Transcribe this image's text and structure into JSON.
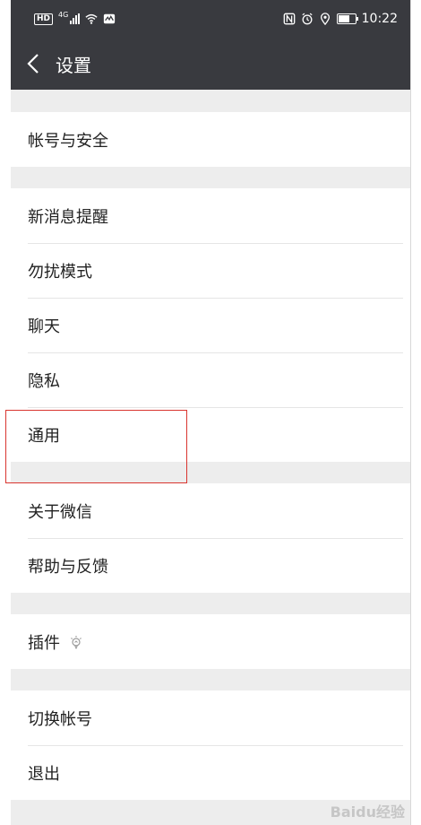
{
  "status_bar": {
    "hd": "HD",
    "network": "4G",
    "time": "10:22"
  },
  "header": {
    "title": "设置"
  },
  "groups": [
    {
      "items": [
        {
          "label": "帐号与安全"
        }
      ]
    },
    {
      "items": [
        {
          "label": "新消息提醒"
        },
        {
          "label": "勿扰模式"
        },
        {
          "label": "聊天"
        },
        {
          "label": "隐私"
        },
        {
          "label": "通用"
        }
      ]
    },
    {
      "items": [
        {
          "label": "关于微信"
        },
        {
          "label": "帮助与反馈"
        }
      ]
    },
    {
      "items": [
        {
          "label": "插件",
          "icon": "lightbulb-icon"
        }
      ]
    },
    {
      "items": [
        {
          "label": "切换帐号"
        },
        {
          "label": "退出"
        }
      ]
    }
  ],
  "annotation": {
    "highlight_color": "#d9352f",
    "highlighted_item": "通用"
  },
  "watermark": "Baidu经验",
  "colors": {
    "header_bg": "#393a3f",
    "page_bg": "#ededed"
  }
}
